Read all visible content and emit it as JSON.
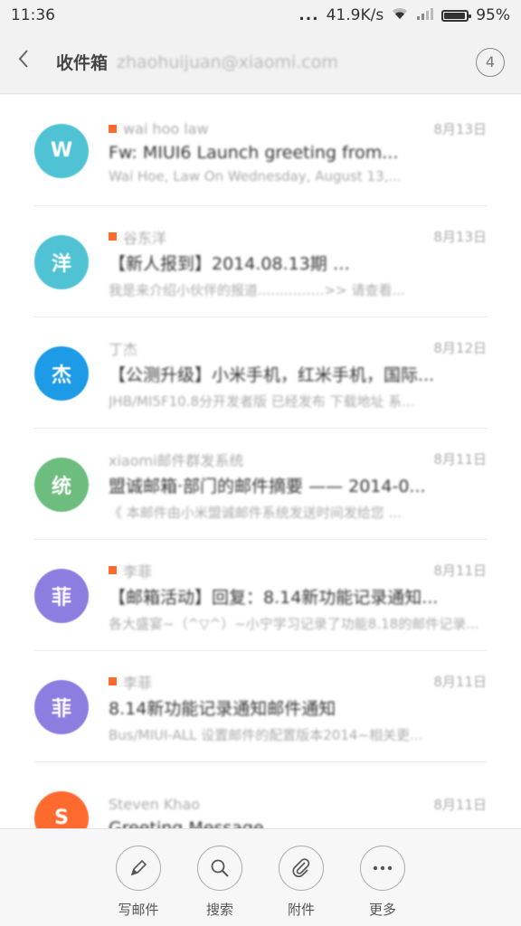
{
  "status_bar": {
    "time": "11:36",
    "dots": "...",
    "net_speed": "41.9K/s",
    "battery": "95%",
    "battery_level": 0.95
  },
  "header": {
    "title": "收件箱",
    "account": "zhaohuijuan@xiaomi.com",
    "count": "4"
  },
  "emails": [
    {
      "avatar_text": "W",
      "avatar_color": "#4fc3d4",
      "flag": true,
      "sender": "wai hoo law",
      "date": "8月13日",
      "subject": "Fw: MIUI6 Launch greeting from...",
      "preview": "Wai Hoe, Law On Wednesday, August 13,..."
    },
    {
      "avatar_text": "洋",
      "avatar_color": "#4fc3d4",
      "flag": true,
      "sender": "谷东洋",
      "date": "8月13日",
      "subject": "【新人报到】2014.08.13期 …",
      "preview": "我是来介绍小伙伴的报道......………>> 请查看..."
    },
    {
      "avatar_text": "杰",
      "avatar_color": "#1e9be6",
      "flag": false,
      "sender": "丁杰",
      "date": "8月12日",
      "subject": "【公测升级】小米手机，红米手机，国际...",
      "preview": "JHB/MI5F10.8分开发者版 已经发布 下载地址 系..."
    },
    {
      "avatar_text": "统",
      "avatar_color": "#6cbd7e",
      "flag": false,
      "sender": "xiaomi邮件群发系统",
      "date": "8月11日",
      "subject": "盟诚邮箱·部门的邮件摘要 —— 2014-0...",
      "preview": "《 本邮件由小米盟诚邮件系统发送时间发给您 ..."
    },
    {
      "avatar_text": "菲",
      "avatar_color": "#8c7de0",
      "flag": true,
      "sender": "李菲",
      "date": "8月11日",
      "subject": "【邮箱活动】回复：8.14新功能记录通知...",
      "preview": "各大盛宴~（^▽^）~小宁学习记录了功能8.18的邮件记录..."
    },
    {
      "avatar_text": "菲",
      "avatar_color": "#8c7de0",
      "flag": true,
      "sender": "李菲",
      "date": "8月11日",
      "subject": "8.14新功能记录通知邮件通知",
      "preview": "Bus/MIUI-ALL 设置邮件的配置版本2014~相关更..."
    },
    {
      "avatar_text": "S",
      "avatar_color": "#ff6a2f",
      "flag": false,
      "sender": "Steven Khao",
      "date": "8月11日",
      "subject": "Greeting Message",
      "preview": ""
    }
  ],
  "actions": [
    {
      "label": "写邮件",
      "icon": "pencil-icon"
    },
    {
      "label": "搜索",
      "icon": "search-icon"
    },
    {
      "label": "附件",
      "icon": "paperclip-icon"
    },
    {
      "label": "更多",
      "icon": "more-icon"
    }
  ]
}
